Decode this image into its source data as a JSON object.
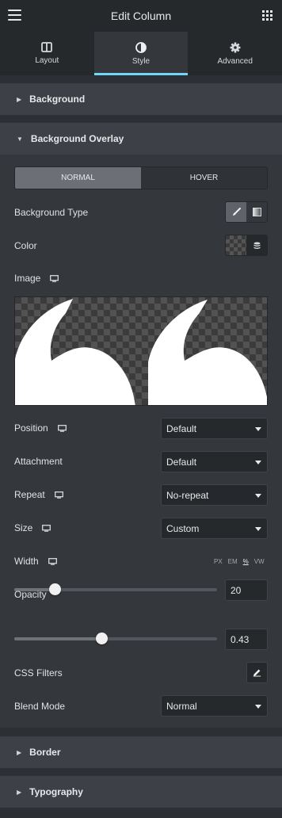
{
  "header": {
    "title": "Edit Column",
    "menu_icon": "hamburger-menu-icon",
    "grid_icon": "apps-grid-icon"
  },
  "tabs": [
    {
      "label": "Layout",
      "icon": "layout-columns-icon",
      "active": false
    },
    {
      "label": "Style",
      "icon": "contrast-circle-icon",
      "active": true
    },
    {
      "label": "Advanced",
      "icon": "gear-icon",
      "active": false
    }
  ],
  "sections": {
    "background": "Background",
    "background_overlay": "Background Overlay",
    "border": "Border",
    "typography": "Typography"
  },
  "state_switcher": {
    "normal": "NORMAL",
    "hover": "HOVER",
    "selected": "normal"
  },
  "controls": {
    "background_type": {
      "label": "Background Type",
      "selected": "classic"
    },
    "color": {
      "label": "Color"
    },
    "image": {
      "label": "Image"
    },
    "position": {
      "label": "Position",
      "value": "Default"
    },
    "attachment": {
      "label": "Attachment",
      "value": "Default"
    },
    "repeat": {
      "label": "Repeat",
      "value": "No-repeat"
    },
    "size": {
      "label": "Size",
      "value": "Custom"
    },
    "width": {
      "label": "Width",
      "value": "20",
      "units": [
        "PX",
        "EM",
        "%",
        "VW"
      ],
      "active_unit": "%",
      "level": 0.2
    },
    "opacity": {
      "label": "Opacity",
      "value": "0.43",
      "level": 0.43
    },
    "css_filters": {
      "label": "CSS Filters",
      "icon": "pencil-icon"
    },
    "blend_mode": {
      "label": "Blend Mode",
      "value": "Normal"
    }
  },
  "colors": {
    "accent": "#71d7f7",
    "panel": "#34373c",
    "header": "#26292c"
  }
}
